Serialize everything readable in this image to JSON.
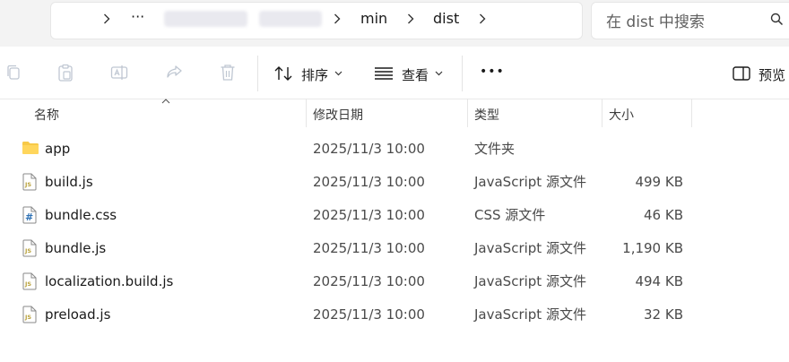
{
  "address": {
    "breadcrumb": [
      "min",
      "dist"
    ],
    "more": "···"
  },
  "search": {
    "placeholder": "在 dist 中搜索"
  },
  "toolbar": {
    "sort_label": "排序",
    "view_label": "查看",
    "more_label": "•••",
    "preview_label": "预览"
  },
  "columns": {
    "name": "名称",
    "date": "修改日期",
    "type": "类型",
    "size": "大小"
  },
  "files": [
    {
      "name": "app",
      "date": "2025/11/3 10:00",
      "type": "文件夹",
      "size": "",
      "icon": "folder-icon"
    },
    {
      "name": "build.js",
      "date": "2025/11/3 10:00",
      "type": "JavaScript 源文件",
      "size": "499 KB",
      "icon": "js-file-icon"
    },
    {
      "name": "bundle.css",
      "date": "2025/11/3 10:00",
      "type": "CSS 源文件",
      "size": "46 KB",
      "icon": "css-file-icon"
    },
    {
      "name": "bundle.js",
      "date": "2025/11/3 10:00",
      "type": "JavaScript 源文件",
      "size": "1,190 KB",
      "icon": "js-file-icon"
    },
    {
      "name": "localization.build.js",
      "date": "2025/11/3 10:00",
      "type": "JavaScript 源文件",
      "size": "494 KB",
      "icon": "js-file-icon"
    },
    {
      "name": "preload.js",
      "date": "2025/11/3 10:00",
      "type": "JavaScript 源文件",
      "size": "32 KB",
      "icon": "js-file-icon"
    }
  ],
  "colors": {
    "folder": "#f7c948",
    "accent": "#0067c0"
  }
}
